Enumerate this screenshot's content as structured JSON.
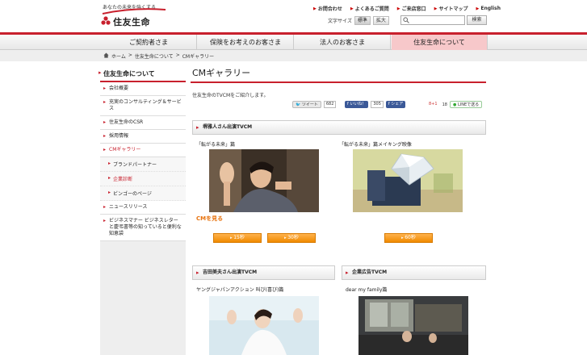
{
  "header": {
    "tagline": "あなたの未来を強くする",
    "logo_text": "住友生命",
    "utility": [
      {
        "label": "お問合わせ"
      },
      {
        "label": "よくあるご質問"
      },
      {
        "label": "ご来店窓口"
      },
      {
        "label": "サイトマップ"
      },
      {
        "label": "English"
      }
    ],
    "fontsize_label": "文字サイズ",
    "fontsize_normal": "標準",
    "fontsize_large": "拡大",
    "search_placeholder": "",
    "search_button": "検索"
  },
  "nav": [
    {
      "label": "ご契約者さま"
    },
    {
      "label": "保険をお考えのお客さま"
    },
    {
      "label": "法人のお客さま"
    },
    {
      "label": "住友生命について"
    }
  ],
  "breadcrumb": [
    "ホーム",
    ">",
    "住友生命について",
    ">",
    "CMギャラリー"
  ],
  "sidebar": {
    "title": "住友生命について",
    "items": [
      {
        "label": "会社概要"
      },
      {
        "label": "充実のコンサルティング＆サービス"
      },
      {
        "label": "住友生命のCSR"
      },
      {
        "label": "採用情報"
      },
      {
        "label": "CMギャラリー"
      }
    ],
    "subs": [
      {
        "label": "ブランドパートナー"
      },
      {
        "label": "企業診断"
      },
      {
        "label": "ビンゴーのページ"
      }
    ],
    "items2": [
      {
        "label": "ニュースリリース"
      },
      {
        "label": "ビジネスマナー ビジネスレターと慶弔書等の知っていると便利な知恵袋"
      }
    ]
  },
  "main": {
    "title": "CMギャラリー",
    "intro": "住友生命のTVCMをご紹介します。",
    "share": {
      "tweet": "ツイート",
      "tweet_count": "682",
      "like": "いいね！",
      "like_count": "305",
      "fb_share": "シェア",
      "gplus": "8+1",
      "gplus_count": "18",
      "line": "LINEで送る"
    },
    "panel1": {
      "head": "堺雅人さん出演TVCM",
      "cm1_caption": "「転がる未来」篇",
      "cm2_caption": "「転がる未来」篇メイキング映像",
      "watch": "CMを見る",
      "btn_15": "15秒",
      "btn_30": "30秒",
      "btn_60": "60秒"
    },
    "panel2": {
      "head": "吉田美夫さん出演TVCM",
      "caption": "ヤングジャパンアクション 叫び(喜び)篇"
    },
    "panel3": {
      "head": "企業広告TVCM",
      "caption": "dear my family篇"
    }
  },
  "colors": {
    "brand_red": "#c8202d",
    "orange": "#f08a00"
  }
}
